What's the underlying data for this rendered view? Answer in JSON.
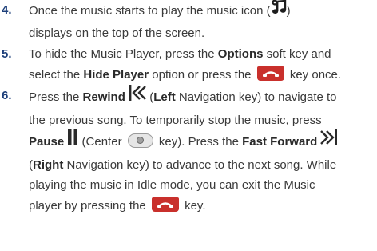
{
  "steps": [
    {
      "number": "4.",
      "t1": "Once the music starts to play the music icon (",
      "t2": ")",
      "t3": "displays on the top of the screen."
    },
    {
      "number": "5.",
      "t1": "To hide the Music Player, press the ",
      "b1": "Options",
      "t2": " soft key and",
      "t3": "select the ",
      "b2": "Hide Player",
      "t4": " option or press the ",
      "t5": " key once."
    },
    {
      "number": "6.",
      "l1a": "Press the ",
      "l1b": "Rewind",
      "l1c": " (",
      "l1d": "Left",
      "l1e": " Navigation key) to navigate to",
      "l2": "the previous song. To temporarily stop the music, press",
      "l3a": "Pause",
      "l3b": " (Center ",
      "l3c": " key). Press the ",
      "l3d": "Fast Forward",
      "l4a": "(",
      "l4b": "Right",
      "l4c": " Navigation key) to advance to the next song. While",
      "l5": "playing the music in Idle mode, you can exit the Music",
      "l6a": "player by pressing the ",
      "l6b": " key."
    }
  ],
  "icons": {
    "music": "music-note-icon",
    "end_key": "end-power-key-icon",
    "rewind": "rewind-icon",
    "pause": "pause-icon",
    "center_key": "center-key-icon",
    "fast_forward": "fast-forward-icon"
  },
  "colors": {
    "step_number": "#1d3f7a",
    "body_text": "#3a3a3a",
    "end_key": "#c9302c"
  }
}
